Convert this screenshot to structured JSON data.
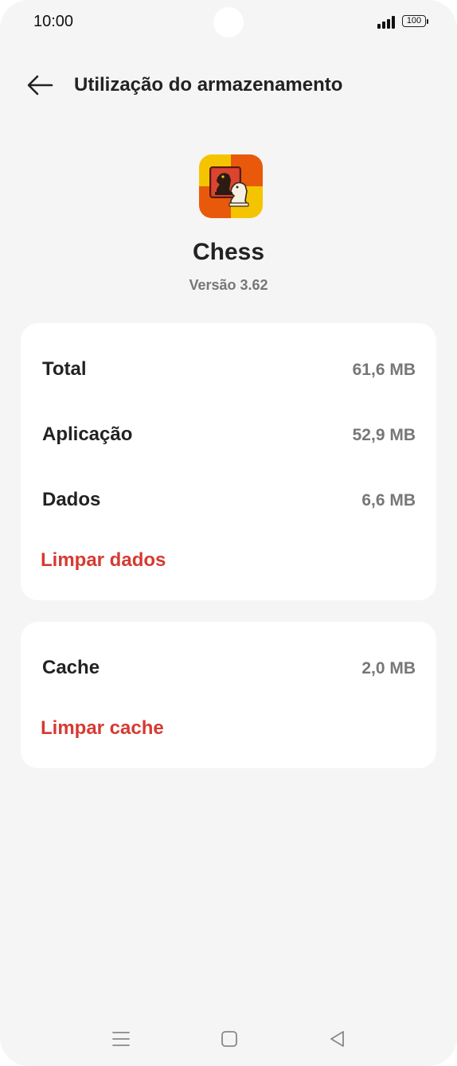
{
  "status_bar": {
    "time": "10:00",
    "battery": "100",
    "icons": [
      "signal-icon",
      "battery-icon"
    ]
  },
  "header": {
    "title": "Utilização do armazenamento",
    "back_icon": "arrow-left-icon"
  },
  "app": {
    "name": "Chess",
    "version": "Versão 3.62",
    "icon": "chess-knight-app-icon",
    "icon_colors": [
      "#f5c400",
      "#e8590c",
      "#c0392b"
    ]
  },
  "storage": {
    "rows": [
      {
        "label": "Total",
        "value": "61,6 MB"
      },
      {
        "label": "Aplicação",
        "value": "52,9 MB"
      },
      {
        "label": "Dados",
        "value": "6,6 MB"
      }
    ],
    "clear_data_label": "Limpar dados"
  },
  "cache": {
    "label": "Cache",
    "value": "2,0 MB",
    "clear_cache_label": "Limpar cache"
  },
  "nav_bar": {
    "icons": [
      "menu-icon",
      "home-icon",
      "back-triangle-icon"
    ]
  },
  "colors": {
    "background": "#f5f5f5",
    "card": "#ffffff",
    "accent_red": "#d63a32",
    "text_primary": "#222222",
    "text_secondary": "#777777"
  }
}
